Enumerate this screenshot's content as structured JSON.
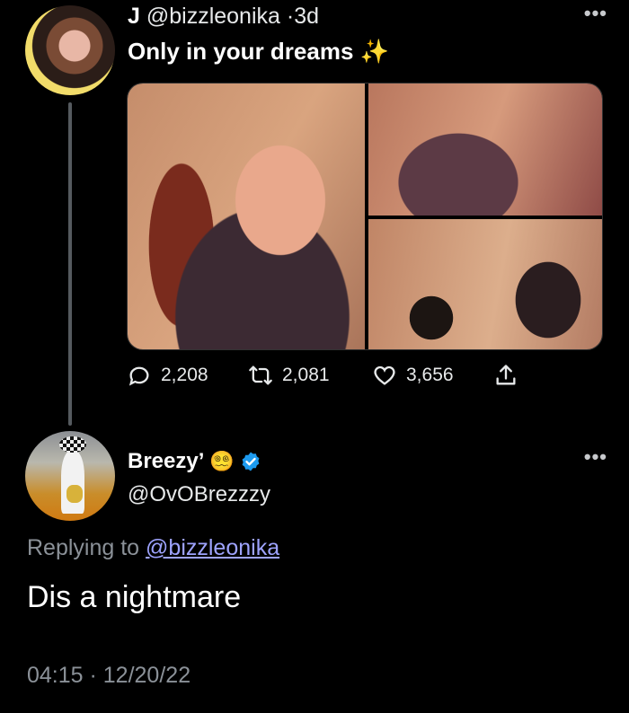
{
  "tweet1": {
    "name": "J",
    "handle": "@bizzleonika",
    "separator": "·",
    "age": "3d",
    "text": "Only in your dreams",
    "emoji": "✨",
    "more_icon": "more-horizontal-icon",
    "stats": {
      "replies": "2,208",
      "retweets": "2,081",
      "likes": "3,656"
    }
  },
  "tweet2": {
    "name": "Breezy’",
    "emoji": "😵‍💫",
    "handle": "@OvOBrezzzy",
    "replying_prefix": "Replying to",
    "replying_handle": "@bizzleonika",
    "text": "Dis a nightmare",
    "timestamp": "04:15 · 12/20/22",
    "more_icon": "more-horizontal-icon"
  },
  "colors": {
    "background": "#000000",
    "text": "#e7e9ea",
    "muted": "#8b9198",
    "verified": "#1d9bf0",
    "mention": "#9ea3ff"
  }
}
